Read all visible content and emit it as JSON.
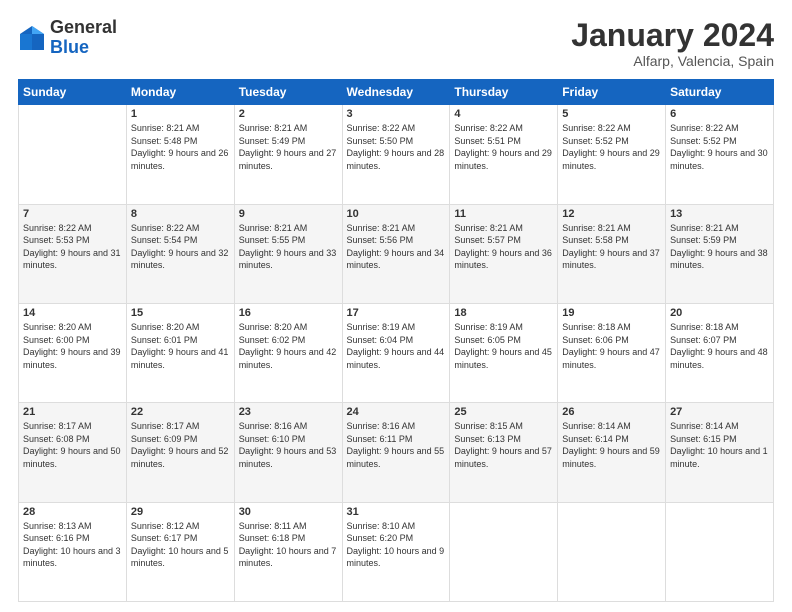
{
  "header": {
    "logo": {
      "general": "General",
      "blue": "Blue"
    },
    "title": "January 2024",
    "subtitle": "Alfarp, Valencia, Spain"
  },
  "days_of_week": [
    "Sunday",
    "Monday",
    "Tuesday",
    "Wednesday",
    "Thursday",
    "Friday",
    "Saturday"
  ],
  "weeks": [
    [
      {
        "day": "",
        "sunrise": "",
        "sunset": "",
        "daylight": ""
      },
      {
        "day": "1",
        "sunrise": "Sunrise: 8:21 AM",
        "sunset": "Sunset: 5:48 PM",
        "daylight": "Daylight: 9 hours and 26 minutes."
      },
      {
        "day": "2",
        "sunrise": "Sunrise: 8:21 AM",
        "sunset": "Sunset: 5:49 PM",
        "daylight": "Daylight: 9 hours and 27 minutes."
      },
      {
        "day": "3",
        "sunrise": "Sunrise: 8:22 AM",
        "sunset": "Sunset: 5:50 PM",
        "daylight": "Daylight: 9 hours and 28 minutes."
      },
      {
        "day": "4",
        "sunrise": "Sunrise: 8:22 AM",
        "sunset": "Sunset: 5:51 PM",
        "daylight": "Daylight: 9 hours and 29 minutes."
      },
      {
        "day": "5",
        "sunrise": "Sunrise: 8:22 AM",
        "sunset": "Sunset: 5:52 PM",
        "daylight": "Daylight: 9 hours and 29 minutes."
      },
      {
        "day": "6",
        "sunrise": "Sunrise: 8:22 AM",
        "sunset": "Sunset: 5:52 PM",
        "daylight": "Daylight: 9 hours and 30 minutes."
      }
    ],
    [
      {
        "day": "7",
        "sunrise": "Sunrise: 8:22 AM",
        "sunset": "Sunset: 5:53 PM",
        "daylight": "Daylight: 9 hours and 31 minutes."
      },
      {
        "day": "8",
        "sunrise": "Sunrise: 8:22 AM",
        "sunset": "Sunset: 5:54 PM",
        "daylight": "Daylight: 9 hours and 32 minutes."
      },
      {
        "day": "9",
        "sunrise": "Sunrise: 8:21 AM",
        "sunset": "Sunset: 5:55 PM",
        "daylight": "Daylight: 9 hours and 33 minutes."
      },
      {
        "day": "10",
        "sunrise": "Sunrise: 8:21 AM",
        "sunset": "Sunset: 5:56 PM",
        "daylight": "Daylight: 9 hours and 34 minutes."
      },
      {
        "day": "11",
        "sunrise": "Sunrise: 8:21 AM",
        "sunset": "Sunset: 5:57 PM",
        "daylight": "Daylight: 9 hours and 36 minutes."
      },
      {
        "day": "12",
        "sunrise": "Sunrise: 8:21 AM",
        "sunset": "Sunset: 5:58 PM",
        "daylight": "Daylight: 9 hours and 37 minutes."
      },
      {
        "day": "13",
        "sunrise": "Sunrise: 8:21 AM",
        "sunset": "Sunset: 5:59 PM",
        "daylight": "Daylight: 9 hours and 38 minutes."
      }
    ],
    [
      {
        "day": "14",
        "sunrise": "Sunrise: 8:20 AM",
        "sunset": "Sunset: 6:00 PM",
        "daylight": "Daylight: 9 hours and 39 minutes."
      },
      {
        "day": "15",
        "sunrise": "Sunrise: 8:20 AM",
        "sunset": "Sunset: 6:01 PM",
        "daylight": "Daylight: 9 hours and 41 minutes."
      },
      {
        "day": "16",
        "sunrise": "Sunrise: 8:20 AM",
        "sunset": "Sunset: 6:02 PM",
        "daylight": "Daylight: 9 hours and 42 minutes."
      },
      {
        "day": "17",
        "sunrise": "Sunrise: 8:19 AM",
        "sunset": "Sunset: 6:04 PM",
        "daylight": "Daylight: 9 hours and 44 minutes."
      },
      {
        "day": "18",
        "sunrise": "Sunrise: 8:19 AM",
        "sunset": "Sunset: 6:05 PM",
        "daylight": "Daylight: 9 hours and 45 minutes."
      },
      {
        "day": "19",
        "sunrise": "Sunrise: 8:18 AM",
        "sunset": "Sunset: 6:06 PM",
        "daylight": "Daylight: 9 hours and 47 minutes."
      },
      {
        "day": "20",
        "sunrise": "Sunrise: 8:18 AM",
        "sunset": "Sunset: 6:07 PM",
        "daylight": "Daylight: 9 hours and 48 minutes."
      }
    ],
    [
      {
        "day": "21",
        "sunrise": "Sunrise: 8:17 AM",
        "sunset": "Sunset: 6:08 PM",
        "daylight": "Daylight: 9 hours and 50 minutes."
      },
      {
        "day": "22",
        "sunrise": "Sunrise: 8:17 AM",
        "sunset": "Sunset: 6:09 PM",
        "daylight": "Daylight: 9 hours and 52 minutes."
      },
      {
        "day": "23",
        "sunrise": "Sunrise: 8:16 AM",
        "sunset": "Sunset: 6:10 PM",
        "daylight": "Daylight: 9 hours and 53 minutes."
      },
      {
        "day": "24",
        "sunrise": "Sunrise: 8:16 AM",
        "sunset": "Sunset: 6:11 PM",
        "daylight": "Daylight: 9 hours and 55 minutes."
      },
      {
        "day": "25",
        "sunrise": "Sunrise: 8:15 AM",
        "sunset": "Sunset: 6:13 PM",
        "daylight": "Daylight: 9 hours and 57 minutes."
      },
      {
        "day": "26",
        "sunrise": "Sunrise: 8:14 AM",
        "sunset": "Sunset: 6:14 PM",
        "daylight": "Daylight: 9 hours and 59 minutes."
      },
      {
        "day": "27",
        "sunrise": "Sunrise: 8:14 AM",
        "sunset": "Sunset: 6:15 PM",
        "daylight": "Daylight: 10 hours and 1 minute."
      }
    ],
    [
      {
        "day": "28",
        "sunrise": "Sunrise: 8:13 AM",
        "sunset": "Sunset: 6:16 PM",
        "daylight": "Daylight: 10 hours and 3 minutes."
      },
      {
        "day": "29",
        "sunrise": "Sunrise: 8:12 AM",
        "sunset": "Sunset: 6:17 PM",
        "daylight": "Daylight: 10 hours and 5 minutes."
      },
      {
        "day": "30",
        "sunrise": "Sunrise: 8:11 AM",
        "sunset": "Sunset: 6:18 PM",
        "daylight": "Daylight: 10 hours and 7 minutes."
      },
      {
        "day": "31",
        "sunrise": "Sunrise: 8:10 AM",
        "sunset": "Sunset: 6:20 PM",
        "daylight": "Daylight: 10 hours and 9 minutes."
      },
      {
        "day": "",
        "sunrise": "",
        "sunset": "",
        "daylight": ""
      },
      {
        "day": "",
        "sunrise": "",
        "sunset": "",
        "daylight": ""
      },
      {
        "day": "",
        "sunrise": "",
        "sunset": "",
        "daylight": ""
      }
    ]
  ]
}
